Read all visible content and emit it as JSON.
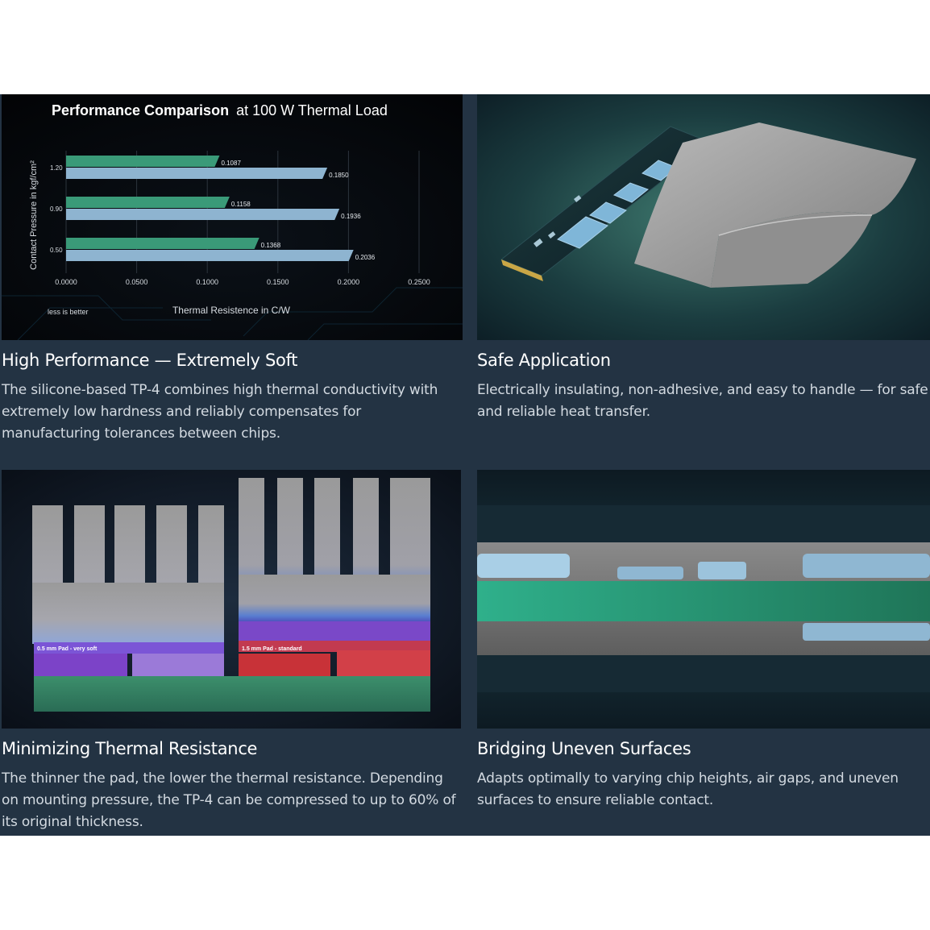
{
  "cards": [
    {
      "title": "High Performance — Extremely Soft",
      "desc": "The silicone-based TP-4 combines high thermal conductivity with extremely low hardness and reliably compensates for manufacturing tolerances between chips."
    },
    {
      "title": "Safe Application",
      "desc": "Electrically insulating, non-adhesive, and easy to handle — for safe and reliable heat transfer."
    },
    {
      "title": "Minimizing Thermal Resistance",
      "desc": "The thinner the pad, the lower the thermal resistance. Depending on mounting pressure, the TP-4 can be compressed to up to 60% of its original thickness."
    },
    {
      "title": "Bridging Uneven Surfaces",
      "desc": "Adapts optimally to varying chip heights, air gaps, and uneven surfaces to ensure reliable contact."
    }
  ],
  "chart_data": {
    "type": "bar",
    "title_bold": "Performance Comparison",
    "title_rest": "at 100 W Thermal Load",
    "xlabel": "Thermal Resistence in C/W",
    "ylabel": "Contact Pressure in kgf/cm²",
    "note": "less is better",
    "categories": [
      "1.20",
      "0.90",
      "0.50"
    ],
    "series": [
      {
        "values": [
          0.1087,
          0.1158,
          0.1368
        ],
        "value_labels": [
          "0.1087",
          "0.1158",
          "0.1368"
        ],
        "color": "#3a9a78"
      },
      {
        "values": [
          0.185,
          0.1936,
          0.2036
        ],
        "value_labels": [
          "0.1850",
          "0.1936",
          "0.2036"
        ],
        "color": "#8eb4d0"
      }
    ],
    "xlim": [
      0,
      0.25
    ],
    "xticks": [
      "0.0000",
      "0.0500",
      "0.1000",
      "0.1500",
      "0.2000",
      "0.2500"
    ],
    "grid": true
  },
  "diagram_labels": {
    "left_pad": "0.5 mm Pad - very soft",
    "right_pad": "1.5 mm Pad - standard"
  },
  "colors": {
    "panel_bg": "#233343",
    "title": "#ffffff",
    "body_text": "#d3dae1"
  }
}
